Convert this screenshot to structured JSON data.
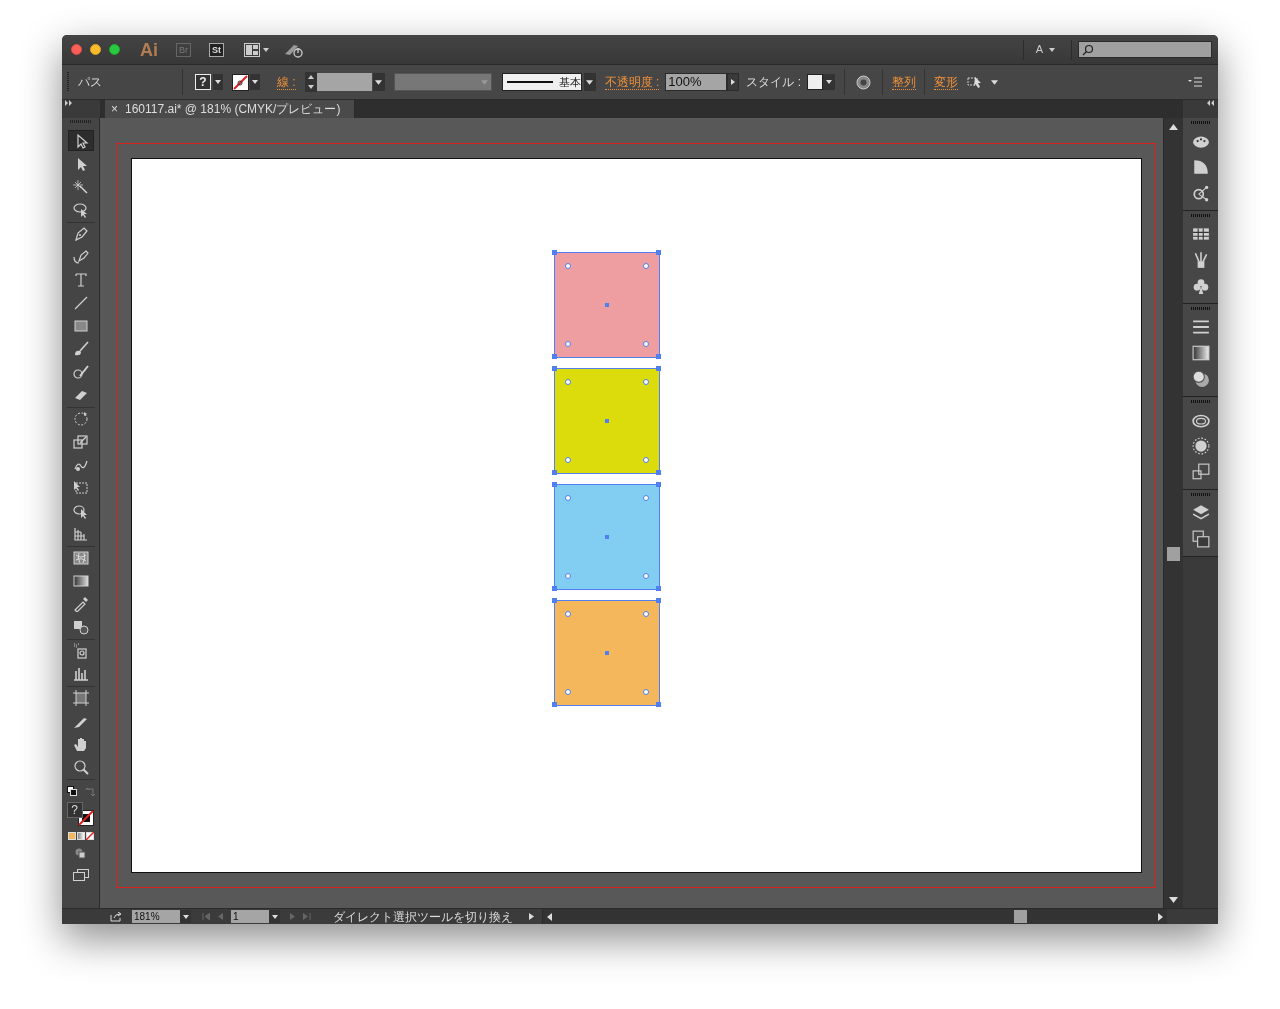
{
  "app_bar": {
    "logo": "Ai",
    "bridge": "Br",
    "stock": "St",
    "user_menu": "A"
  },
  "control_bar": {
    "selection_type": "パス",
    "fill_swatch": "?",
    "stroke_label": "線 :",
    "stroke_profile": "基本",
    "opacity_label": "不透明度 :",
    "opacity": "100%",
    "style_label": "スタイル :",
    "align": "整列",
    "transform": "変形"
  },
  "document_tab": {
    "close": "×",
    "title": "160117.ai* @ 181% (CMYK/プレビュー)"
  },
  "tools": [
    {
      "selected": true
    },
    {
      "selected": false
    },
    {
      "selected": false
    },
    {
      "selected": false
    },
    {
      "selected": false
    },
    {
      "selected": false
    },
    {
      "selected": false
    },
    {
      "selected": false
    },
    {
      "selected": false
    },
    {
      "selected": false
    },
    {
      "selected": false
    },
    {
      "selected": false
    },
    {
      "selected": false
    },
    {
      "selected": false
    },
    {
      "selected": false
    },
    {
      "selected": false
    },
    {
      "selected": false
    },
    {
      "selected": false
    },
    {
      "selected": false
    },
    {
      "selected": false
    },
    {
      "selected": false
    },
    {
      "selected": false
    },
    {
      "selected": false
    },
    {
      "selected": false
    },
    {
      "selected": false
    },
    {
      "selected": false
    },
    {
      "selected": false
    },
    {
      "selected": false
    }
  ],
  "toolbox_fill": "?",
  "artboard": {
    "shapes": [
      {
        "color": "#ee9ea0",
        "selected": true
      },
      {
        "color": "#dcdc0c",
        "selected": true
      },
      {
        "color": "#82cdf2",
        "selected": true
      },
      {
        "color": "#f5b75c",
        "selected": true
      }
    ]
  },
  "status_bar": {
    "zoom": "181%",
    "artboard_number": "1",
    "current_tool": "ダイレクト選択ツールを切り換え"
  }
}
